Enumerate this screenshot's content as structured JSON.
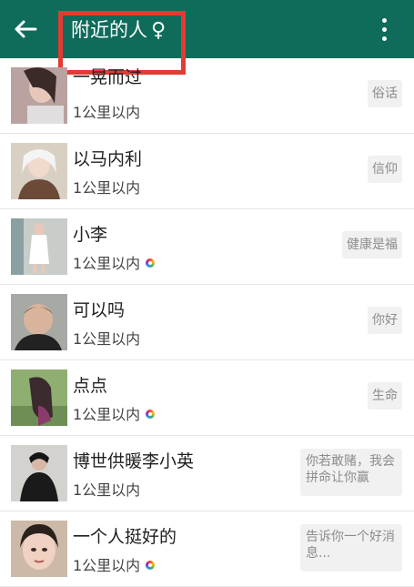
{
  "header": {
    "title": "附近的人",
    "gender_symbol": "♀",
    "colors": {
      "bar": "#0f6b5a",
      "highlight": "#e53935"
    }
  },
  "people": [
    {
      "name": "一晃而过",
      "distance": "1公里以内",
      "verified": false,
      "signature": "俗话"
    },
    {
      "name": "以马内利",
      "distance": "1公里以内",
      "verified": false,
      "signature": "信仰"
    },
    {
      "name": "小李",
      "distance": "1公里以内",
      "verified": true,
      "signature": "健康是福"
    },
    {
      "name": "可以吗",
      "distance": "1公里以内",
      "verified": false,
      "signature": "你好"
    },
    {
      "name": "点点",
      "distance": "1公里以内",
      "verified": true,
      "signature": "生命"
    },
    {
      "name": "博世供暖李小英",
      "distance": "1公里以内",
      "verified": false,
      "signature": "你若敢赌，我会拼命让你赢"
    },
    {
      "name": "一个人挺好的",
      "distance": "1公里以内",
      "verified": true,
      "signature": "告诉你一个好消息..."
    }
  ]
}
